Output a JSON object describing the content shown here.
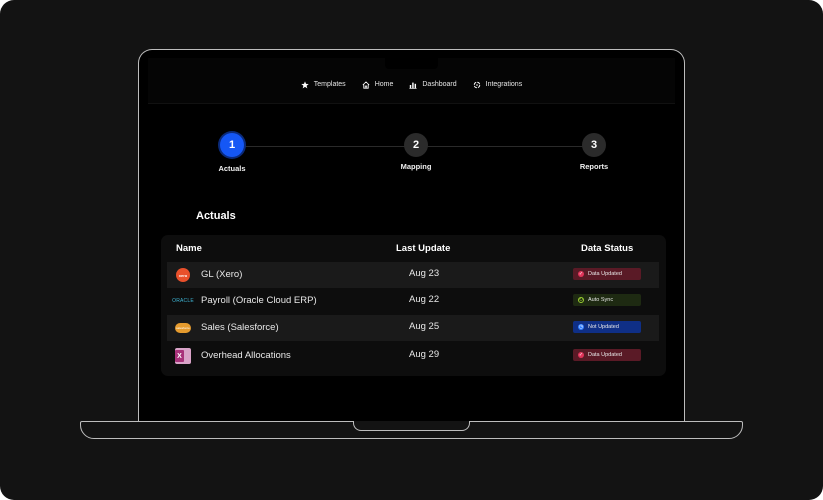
{
  "nav": {
    "items": [
      {
        "label": "Templates",
        "icon": "star-icon"
      },
      {
        "label": "Home",
        "icon": "home-icon"
      },
      {
        "label": "Dashboard",
        "icon": "bar-chart-icon"
      },
      {
        "label": "Integrations",
        "icon": "integrations-icon"
      }
    ]
  },
  "stepper": {
    "steps": [
      {
        "number": "1",
        "label": "Actuals",
        "active": true
      },
      {
        "number": "2",
        "label": "Mapping",
        "active": false
      },
      {
        "number": "3",
        "label": "Reports",
        "active": false
      }
    ]
  },
  "section": {
    "title": "Actuals"
  },
  "table": {
    "headers": {
      "name": "Name",
      "last_update": "Last Update",
      "data_status": "Data Status"
    },
    "rows": [
      {
        "name": "GL (Xero)",
        "logo": "xero-logo",
        "logo_text": "xero",
        "last_update": "Aug 23",
        "status": "Data Updated",
        "status_icon": "check-icon"
      },
      {
        "name": "Payroll (Oracle Cloud ERP)",
        "logo": "oracle-logo",
        "logo_text": "ORACLE",
        "last_update": "Aug 22",
        "status": "Auto Sync",
        "status_icon": "sync-icon"
      },
      {
        "name": "Sales (Salesforce)",
        "logo": "salesforce-logo",
        "logo_text": "salesforce",
        "last_update": "Aug 25",
        "status": "Not Updated",
        "status_icon": "clock-icon"
      },
      {
        "name": "Overhead Allocations",
        "logo": "excel-logo",
        "logo_text": "X",
        "last_update": "Aug 29",
        "status": "Data Updated",
        "status_icon": "check-icon"
      }
    ]
  },
  "colors": {
    "accent": "#1557f5",
    "status_updated_bg": "#5a1a26",
    "status_updated_dot": "#e0345a",
    "status_sync_bg": "#1e2a12",
    "status_sync_dot": "#9acd32",
    "status_not_updated_bg": "#0f2f86",
    "status_not_updated_dot": "#2f7cff"
  }
}
